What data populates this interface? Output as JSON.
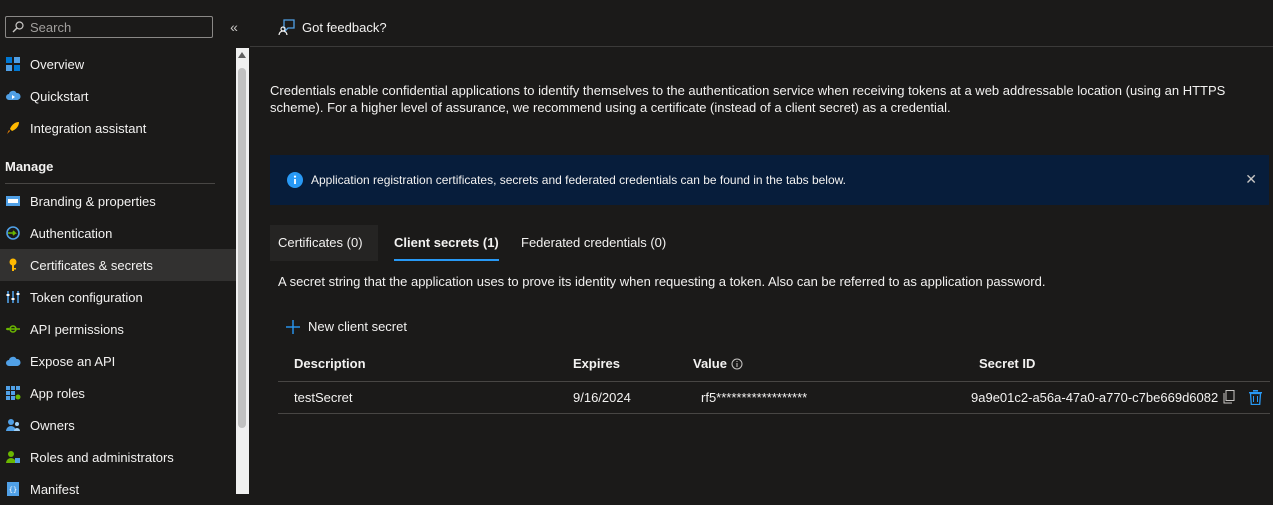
{
  "sidebar": {
    "search_placeholder": "Search",
    "collapse_glyph": "«",
    "items_top": [
      {
        "label": "Overview",
        "icon": "overview-icon"
      },
      {
        "label": "Quickstart",
        "icon": "quickstart-cloud-icon"
      },
      {
        "label": "Integration assistant",
        "icon": "rocket-icon"
      }
    ],
    "section_title": "Manage",
    "items_manage": [
      {
        "label": "Branding & properties",
        "icon": "branding-icon"
      },
      {
        "label": "Authentication",
        "icon": "authentication-icon"
      },
      {
        "label": "Certificates & secrets",
        "icon": "key-icon",
        "active": true
      },
      {
        "label": "Token configuration",
        "icon": "token-config-icon"
      },
      {
        "label": "API permissions",
        "icon": "api-permissions-icon"
      },
      {
        "label": "Expose an API",
        "icon": "expose-api-cloud-icon"
      },
      {
        "label": "App roles",
        "icon": "app-roles-icon"
      },
      {
        "label": "Owners",
        "icon": "owners-icon"
      },
      {
        "label": "Roles and administrators",
        "icon": "roles-admins-icon"
      },
      {
        "label": "Manifest",
        "icon": "manifest-icon"
      }
    ]
  },
  "header": {
    "feedback_label": "Got feedback?"
  },
  "main": {
    "intro": "Credentials enable confidential applications to identify themselves to the authentication service when receiving tokens at a web addressable location (using an HTTPS scheme). For a higher level of assurance, we recommend using a certificate (instead of a client secret) as a credential.",
    "info_banner": "Application registration certificates, secrets and federated credentials can be found in the tabs below.",
    "tabs": [
      {
        "label": "Certificates (0)"
      },
      {
        "label": "Client secrets (1)",
        "selected": true
      },
      {
        "label": "Federated credentials (0)"
      }
    ],
    "tab_description": "A secret string that the application uses to prove its identity when requesting a token. Also can be referred to as application password.",
    "new_secret_label": "New client secret",
    "table": {
      "columns": [
        "Description",
        "Expires",
        "Value",
        "Secret ID"
      ],
      "rows": [
        {
          "description": "testSecret",
          "expires": "9/16/2024",
          "value": "rf5******************",
          "secret_id": "9a9e01c2-a56a-47a0-a770-c7be669d6082"
        }
      ]
    }
  },
  "colors": {
    "background": "#1b1a19",
    "accent": "#2899f5",
    "info_bar": "#071d3b",
    "active_nav": "#323130",
    "delete_icon": "#2899f5"
  }
}
